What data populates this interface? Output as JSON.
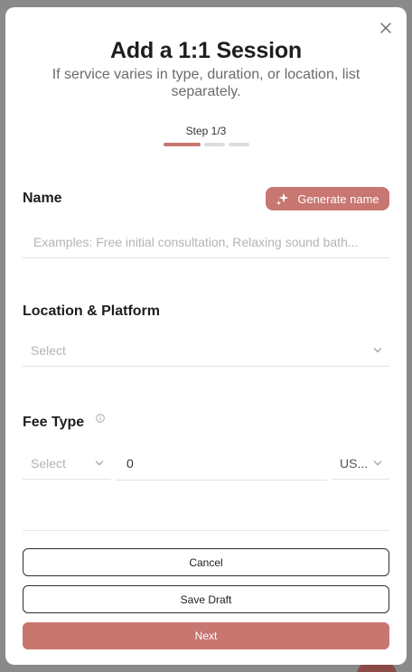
{
  "modal": {
    "title": "Add a 1:1 Session",
    "subtitle": "If service varies in type, duration, or location, list separately.",
    "close_icon": "close-icon"
  },
  "stepper": {
    "label": "Step 1/3",
    "current_step": 1,
    "total_steps": 3
  },
  "name_section": {
    "label": "Name",
    "generate_button": "Generate name",
    "generate_icon": "sparkle-icon",
    "input_placeholder": "Examples: Free initial consultation, Relaxing sound bath...",
    "input_value": ""
  },
  "location_section": {
    "label": "Location & Platform",
    "select_placeholder": "Select"
  },
  "fee_section": {
    "label": "Fee Type",
    "info_icon": "info-icon",
    "type_placeholder": "Select",
    "amount_value": "0",
    "currency_value": "US..."
  },
  "actions": {
    "cancel_label": "Cancel",
    "save_draft_label": "Save Draft",
    "next_label": "Next"
  },
  "colors": {
    "accent": "#c87670",
    "muted_bar": "#dcdce2",
    "text_dark": "#1e1e1e",
    "placeholder": "#b4b4b4"
  }
}
